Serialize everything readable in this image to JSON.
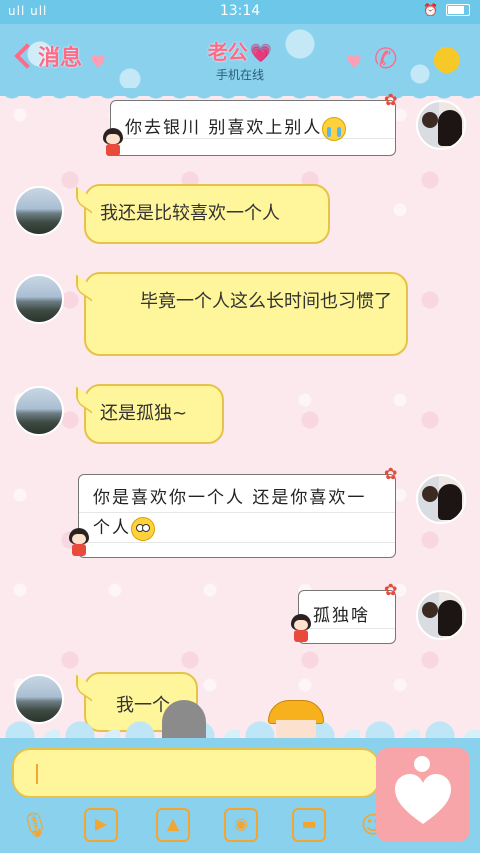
{
  "status_bar": {
    "signal": "ull ull",
    "time": "13:14"
  },
  "header": {
    "back_label": "消息",
    "title": "老公",
    "subtitle": "手机在线"
  },
  "messages": [
    {
      "side": "right",
      "text": "你去银川  别喜欢上别人",
      "emoji": "crying-emoji"
    },
    {
      "side": "left",
      "text": "我还是比较喜欢一个人"
    },
    {
      "side": "left",
      "text": "毕竟一个人这么长时间也习惯了"
    },
    {
      "side": "left",
      "text": "还是孤独~"
    },
    {
      "side": "right",
      "text": "你是喜欢你一个人  还是你喜欢一个人",
      "emoji": "flushed-emoji"
    },
    {
      "side": "right",
      "text": "孤独啥"
    },
    {
      "side": "left",
      "text": "我一个"
    }
  ],
  "input": {
    "placeholder": ""
  },
  "toolbar": [
    "voice-icon",
    "video-icon",
    "image-icon",
    "camera-icon",
    "file-icon",
    "emoji-icon"
  ]
}
